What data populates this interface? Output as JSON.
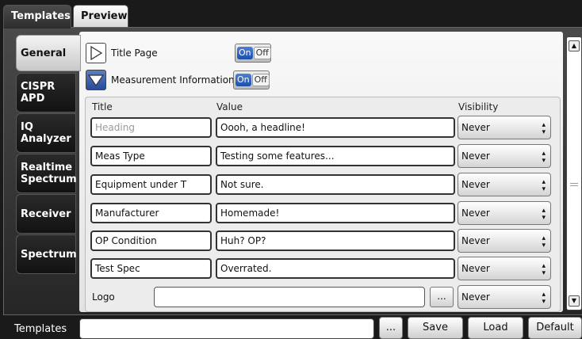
{
  "top_tabs": [
    {
      "label": "Templates",
      "active": true
    },
    {
      "label": "Preview",
      "active": false
    }
  ],
  "side_tabs": [
    {
      "label": "General",
      "active": true
    },
    {
      "label": "CISPR APD",
      "active": false
    },
    {
      "label": "IQ Analyzer",
      "active": false
    },
    {
      "label": "Realtime Spectrum",
      "active": false
    },
    {
      "label": "Receiver",
      "active": false
    },
    {
      "label": "Spectrum",
      "active": false
    }
  ],
  "sections": {
    "title_page": {
      "label": "Title Page",
      "toggle_on": "On",
      "toggle_off": "Off",
      "state": "On"
    },
    "measurement_info": {
      "label": "Measurement Information",
      "toggle_on": "On",
      "toggle_off": "Off",
      "state": "On"
    }
  },
  "table": {
    "headers": {
      "title": "Title",
      "value": "Value",
      "visibility": "Visibility"
    },
    "rows": [
      {
        "title": "",
        "title_placeholder": "Heading",
        "value": "Oooh, a headline!",
        "visibility": "Never"
      },
      {
        "title": "Meas Type",
        "value": "Testing some features...",
        "visibility": "Never"
      },
      {
        "title": "Equipment under T",
        "value": "Not sure.",
        "visibility": "Never"
      },
      {
        "title": "Manufacturer",
        "value": "Homemade!",
        "visibility": "Never"
      },
      {
        "title": "OP Condition",
        "value": "Huh? OP?",
        "visibility": "Never"
      },
      {
        "title": "Test Spec",
        "value": "Overrated.",
        "visibility": "Never"
      }
    ],
    "logo": {
      "label": "Logo",
      "value": "",
      "browse": "...",
      "visibility": "Never"
    }
  },
  "bottom": {
    "label": "Templates",
    "value": "",
    "browse": "...",
    "save": "Save",
    "load": "Load",
    "default": "Default"
  }
}
